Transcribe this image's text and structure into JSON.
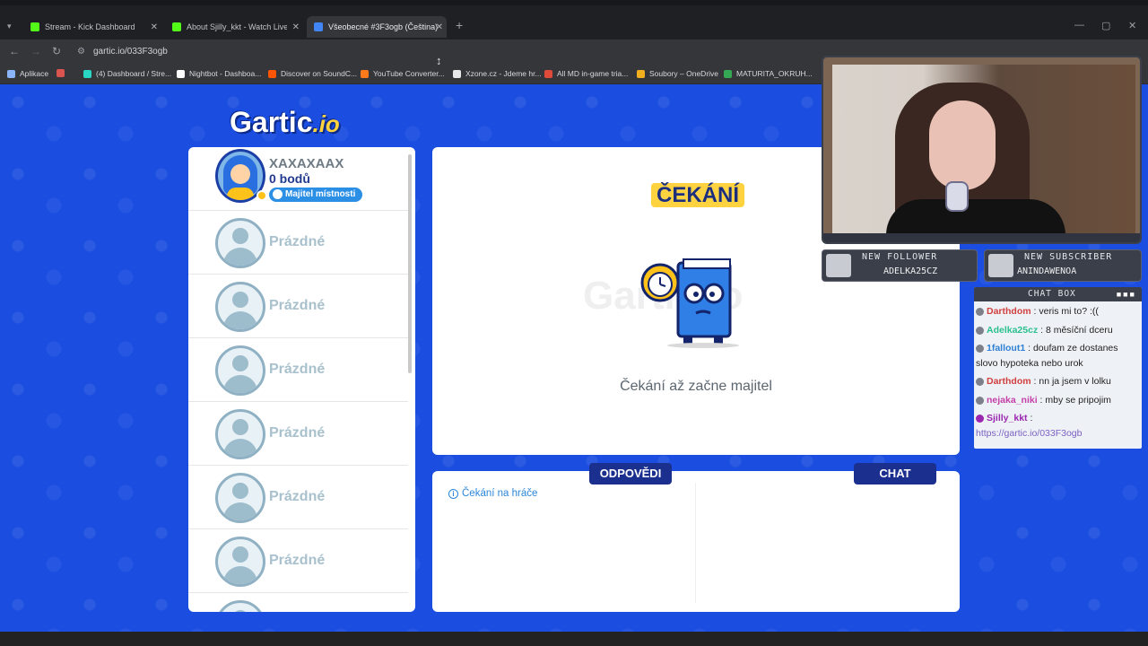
{
  "browser": {
    "tabs": [
      {
        "label": "Stream - Kick Dashboard",
        "fav_color": "#53fc18"
      },
      {
        "label": "About Sjilly_kkt - Watch Live o",
        "fav_color": "#53fc18"
      },
      {
        "label": "Všeobecné #3F3ogb (Čeština)",
        "fav_color": "#4285f4"
      }
    ],
    "url": "gartic.io/033F3ogb",
    "bookmarks": [
      "Aplikace",
      "(4) Dashboard / Stre...",
      "Nightbot - Dashboa...",
      "Discover on SoundC...",
      "YouTube Converter...",
      "Xzone.cz - Jdeme hr...",
      "All MD in-game tria...",
      "Soubory – OneDrive",
      "MATURITA_OKRUH..."
    ]
  },
  "game": {
    "logo_text": "Gartic",
    "logo_suffix": ".io",
    "owner": {
      "name": "XAXAXAAX",
      "points": "0 bodů",
      "badge": "Majitel místnosti"
    },
    "empty_label": "Prázdné",
    "empty_slots": 6,
    "waiting_title": "ČEKÁNÍ",
    "waiting_text": "Čekání až začne majitel",
    "watermark": "Gartic.io",
    "answers_tab": "ODPOVĚDI",
    "chat_tab": "CHAT",
    "answers_hint": "Čekání na hráče"
  },
  "overlay": {
    "new_follower_label": "NEW FOLLOWER",
    "new_follower_value": "ADELKA25CZ",
    "new_subscriber_label": "NEW SUBSCRIBER",
    "new_subscriber_value": "ANINDAWENOA",
    "chat_title": "CHAT BOX",
    "chat_messages": [
      {
        "user": "Darthdom",
        "color": "#d13f3f",
        "text": ": veris mi to? :(("
      },
      {
        "user": "Adelka25cz",
        "color": "#2bbf8f",
        "text": ": 8 měsíční dceru"
      },
      {
        "user": "1fallout1",
        "color": "#2e7fd6",
        "text": ": doufam ze dostanes"
      },
      {
        "user": "",
        "color": "#222",
        "text": "slovo hypoteka nebo urok"
      },
      {
        "user": "Darthdom",
        "color": "#d13f3f",
        "text": ": nn ja jsem v lolku"
      },
      {
        "user": "nejaka_niki",
        "color": "#c43fa8",
        "text": ": mby se pripojim"
      },
      {
        "user": "Sjilly_kkt",
        "color": "#9b27b0",
        "text": ":"
      },
      {
        "user": "",
        "color": "#7b5fc2",
        "text": "https://gartic.io/033F3ogb"
      }
    ]
  }
}
